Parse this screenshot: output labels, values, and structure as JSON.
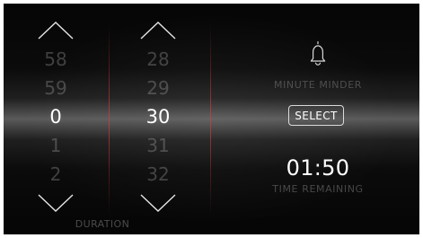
{
  "left_picker": {
    "values": [
      "58",
      "59",
      "0",
      "1",
      "2"
    ],
    "selected": "0"
  },
  "right_picker": {
    "values": [
      "28",
      "29",
      "30",
      "31",
      "32"
    ],
    "selected": "30"
  },
  "labels": {
    "duration": "DURATION",
    "minute_minder": "MINUTE MINDER",
    "select": "SELECT",
    "time_remaining_value": "01:50",
    "time_remaining_label": "TIME REMAINING"
  },
  "icons": {
    "up": "chevron-up-icon",
    "down": "chevron-down-icon",
    "bell": "bell-icon"
  },
  "colors": {
    "background_dark": "#050505",
    "highlight_band": "#5a5a5a",
    "divider_red": "#d23c3c",
    "text_active": "#ffffff",
    "text_muted": "#c8c8c8"
  }
}
